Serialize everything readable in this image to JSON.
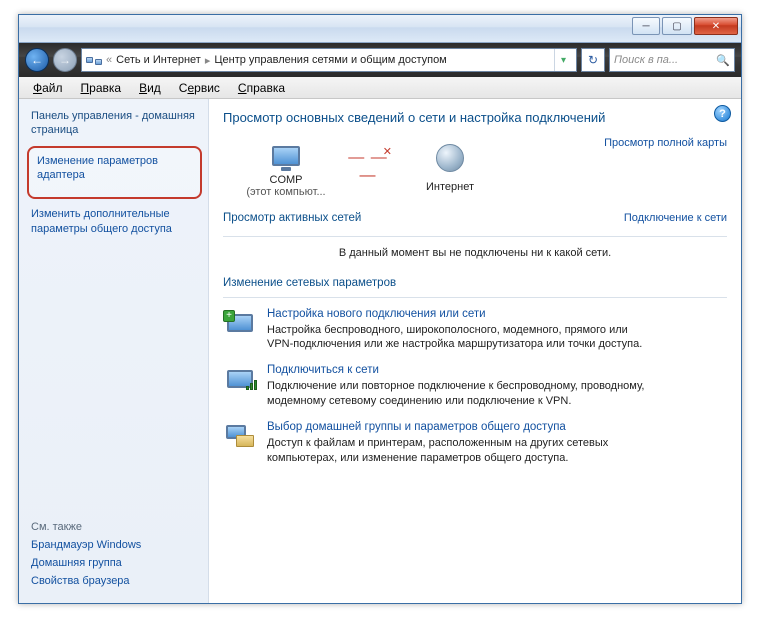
{
  "titlebar": {},
  "address": {
    "crumb1": "Сеть и Интернет",
    "crumb2": "Центр управления сетями и общим доступом",
    "search_placeholder": "Поиск в па..."
  },
  "menu": {
    "file": "Файл",
    "edit": "Правка",
    "view": "Вид",
    "service": "Сервис",
    "help": "Справка"
  },
  "sidebar": {
    "home": "Панель управления - домашняя страница",
    "adapter": "Изменение параметров адаптера",
    "advanced": "Изменить дополнительные параметры общего доступа",
    "see_also": "См. также",
    "fw": "Брандмауэр Windows",
    "hg": "Домашняя группа",
    "browser": "Свойства браузера"
  },
  "main": {
    "heading": "Просмотр основных сведений о сети и настройка подключений",
    "full_map": "Просмотр полной карты",
    "comp": "COMP",
    "comp_sub": "(этот компьют...",
    "internet": "Интернет",
    "active_title": "Просмотр активных сетей",
    "connect_link": "Подключение к сети",
    "no_net": "В данный момент вы не подключены ни к какой сети.",
    "change_title": "Изменение сетевых параметров",
    "task1_link": "Настройка нового подключения или сети",
    "task1_desc": "Настройка беспроводного, широкополосного, модемного, прямого или VPN-подключения или же настройка маршрутизатора или точки доступа.",
    "task2_link": "Подключиться к сети",
    "task2_desc": "Подключение или повторное подключение к беспроводному, проводному, модемному сетевому соединению или подключение к VPN.",
    "task3_link": "Выбор домашней группы и параметров общего доступа",
    "task3_desc": "Доступ к файлам и принтерам, расположенным на других сетевых компьютерах, или изменение параметров общего доступа."
  }
}
